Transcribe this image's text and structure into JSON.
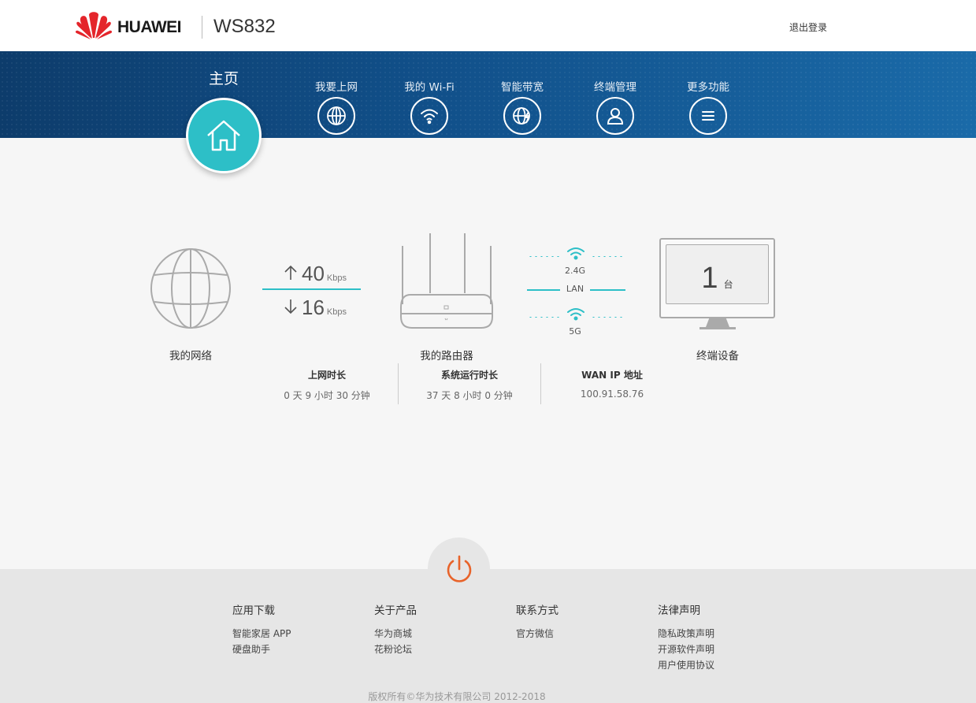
{
  "header": {
    "brand": "HUAWEI",
    "model": "WS832",
    "logout_label": "退出登录"
  },
  "nav": {
    "home_label": "主页",
    "items": [
      {
        "label": "我要上网",
        "icon": "globe-icon"
      },
      {
        "label": "我的 Wi-Fi",
        "icon": "wifi-icon"
      },
      {
        "label": "智能带宽",
        "icon": "globe-bolt-icon"
      },
      {
        "label": "终端管理",
        "icon": "user-icon"
      },
      {
        "label": "更多功能",
        "icon": "menu-icon"
      }
    ]
  },
  "diagram": {
    "network_label": "我的网络",
    "upload_speed": "40",
    "download_speed": "16",
    "speed_unit": "Kbps",
    "router_label": "我的路由器",
    "band_24": "2.4G",
    "band_lan": "LAN",
    "band_5": "5G",
    "device_count": "1",
    "device_unit": "台",
    "devices_label": "终端设备"
  },
  "stats": [
    {
      "title": "上网时长",
      "value": "0 天 9 小时 30 分钟"
    },
    {
      "title": "系统运行时长",
      "value": "37 天 8 小时 0 分钟"
    },
    {
      "title": "WAN IP 地址",
      "value": "100.91.58.76"
    }
  ],
  "footer": {
    "columns": [
      {
        "title": "应用下载",
        "links": [
          "智能家居 APP",
          "硬盘助手"
        ]
      },
      {
        "title": "关于产品",
        "links": [
          "华为商城",
          "花粉论坛"
        ]
      },
      {
        "title": "联系方式",
        "links": [
          "官方微信"
        ]
      },
      {
        "title": "法律声明",
        "links": [
          "隐私政策声明",
          "开源软件声明",
          "用户使用协议"
        ]
      }
    ],
    "copyright": "版权所有©华为技术有限公司 2012-2018"
  },
  "colors": {
    "accent": "#2dbfc7",
    "nav_blue": "#11508a",
    "power": "#e8632a",
    "brand_red": "#e4252b"
  }
}
